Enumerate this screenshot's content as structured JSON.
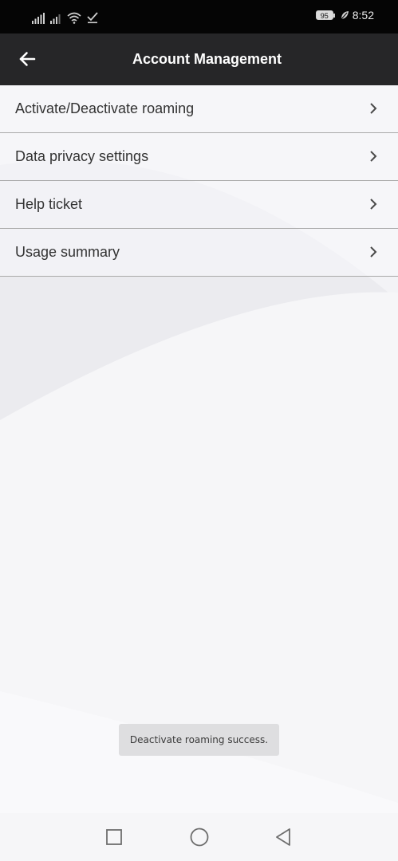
{
  "status_bar": {
    "time": "8:52",
    "battery": "95",
    "icons": [
      "signal-icon",
      "signal-icon",
      "wifi-icon",
      "check-icon",
      "battery-icon",
      "leaf-icon"
    ]
  },
  "app_bar": {
    "title": "Account Management",
    "back_icon": "arrow-left-icon"
  },
  "menu": {
    "items": [
      {
        "label": "Activate/Deactivate roaming",
        "icon": "chevron-right-icon"
      },
      {
        "label": "Data privacy settings",
        "icon": "chevron-right-icon"
      },
      {
        "label": "Help ticket",
        "icon": "chevron-right-icon"
      },
      {
        "label": "Usage summary",
        "icon": "chevron-right-icon"
      }
    ]
  },
  "toast": {
    "message": "Deactivate roaming success."
  },
  "nav_bar": {
    "icons": [
      "square-icon",
      "circle-icon",
      "triangle-back-icon"
    ]
  },
  "colors": {
    "app_bar_bg": "#262628",
    "status_bar_bg": "#050505",
    "page_bg": "#f3f3f6",
    "divider": "#a9a9a9",
    "text": "#333333"
  }
}
